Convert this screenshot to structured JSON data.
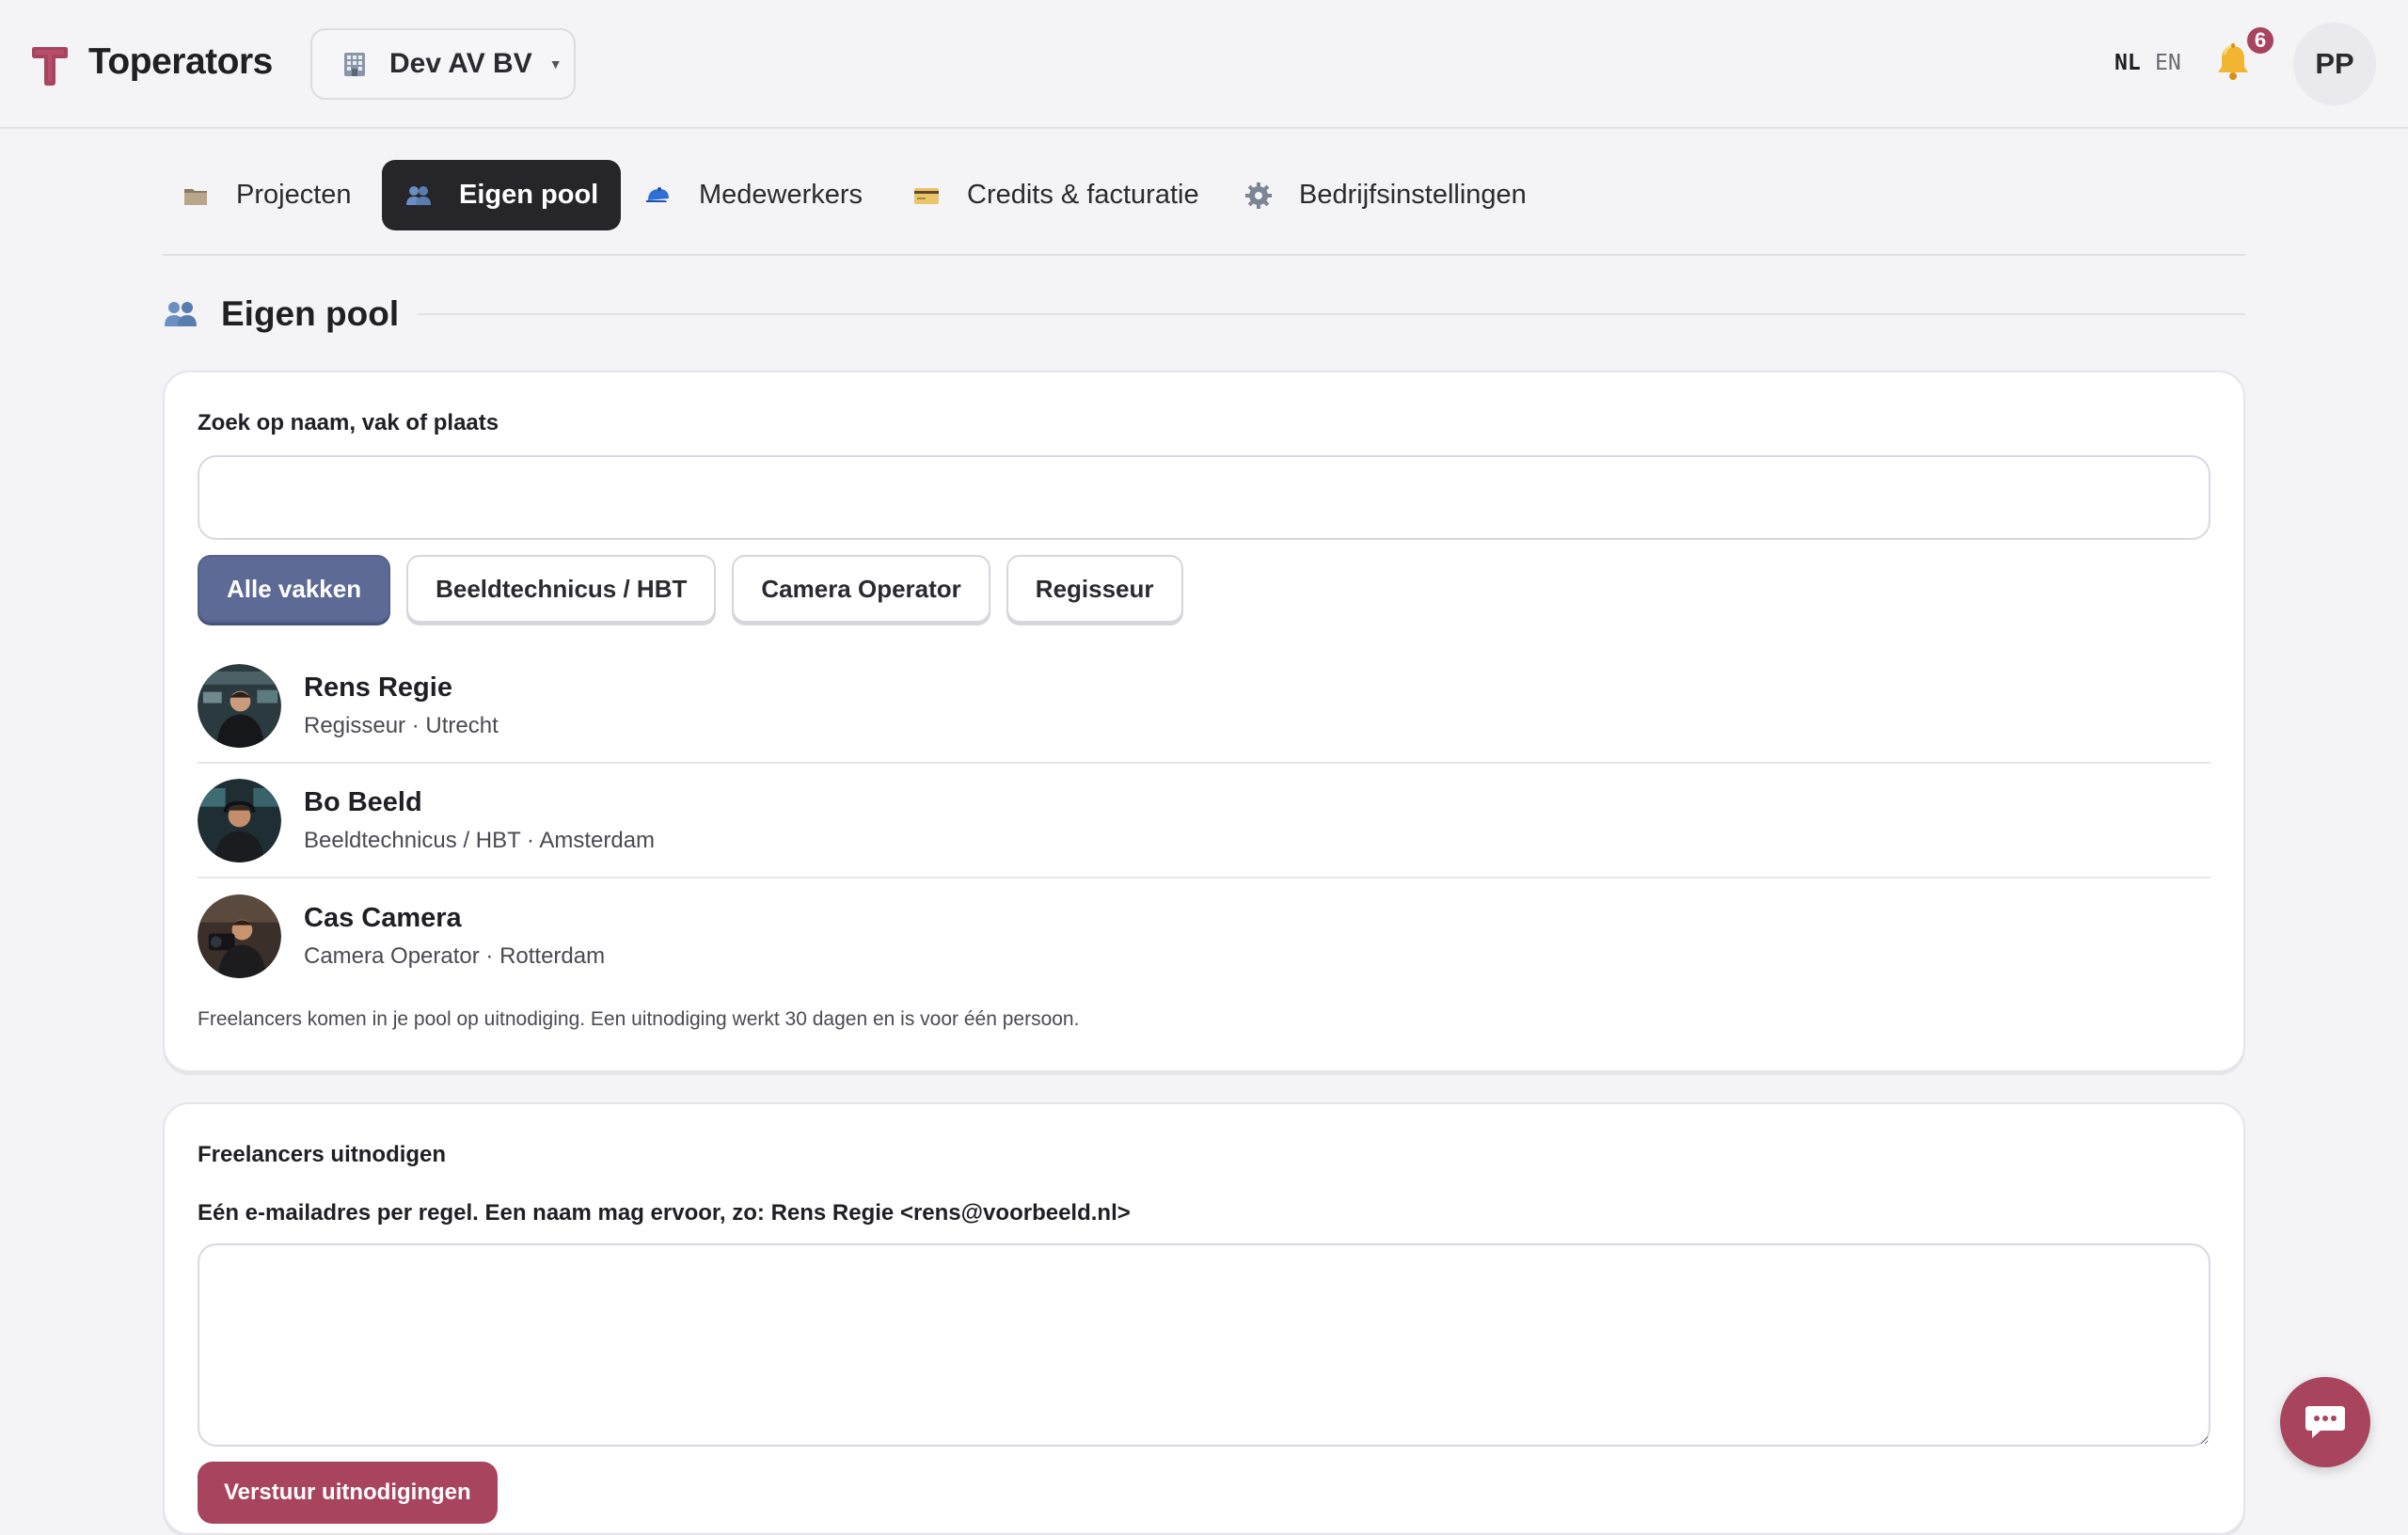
{
  "app": {
    "name": "Toperators",
    "company": "Dev AV BV",
    "languages": [
      {
        "code": "NL",
        "active": true
      },
      {
        "code": "EN",
        "active": false
      }
    ],
    "notifications_count": "6",
    "user_initials": "PP",
    "brand_color": "#a9445f",
    "chip_active_color": "#5c6a95"
  },
  "nav": {
    "tabs": [
      {
        "label": "Projecten",
        "icon": "folder-icon",
        "active": false
      },
      {
        "label": "Eigen pool",
        "icon": "people-icon",
        "active": true
      },
      {
        "label": "Medewerkers",
        "icon": "cap-icon",
        "active": false
      },
      {
        "label": "Credits & facturatie",
        "icon": "credit-card-icon",
        "active": false
      },
      {
        "label": "Bedrijfsinstellingen",
        "icon": "gear-icon",
        "active": false
      }
    ]
  },
  "section": {
    "title": "Eigen pool",
    "icon": "people-icon"
  },
  "pool": {
    "search_label": "Zoek op naam, vak of plaats",
    "search_value": "",
    "filters": [
      {
        "label": "Alle vakken",
        "active": true
      },
      {
        "label": "Beeldtechnicus / HBT",
        "active": false
      },
      {
        "label": "Camera Operator",
        "active": false
      },
      {
        "label": "Regisseur",
        "active": false
      }
    ],
    "people": [
      {
        "name": "Rens Regie",
        "meta": "Regisseur · Utrecht"
      },
      {
        "name": "Bo Beeld",
        "meta": "Beeldtechnicus / HBT · Amsterdam"
      },
      {
        "name": "Cas Camera",
        "meta": "Camera Operator · Rotterdam"
      }
    ],
    "note": "Freelancers komen in je pool op uitnodiging. Een uitnodiging werkt 30 dagen en is voor één persoon."
  },
  "invite": {
    "title": "Freelancers uitnodigen",
    "instructions": "Eén e-mailadres per regel. Een naam mag ervoor, zo: Rens Regie <rens@voorbeeld.nl>",
    "textarea_value": "",
    "submit_label": "Verstuur uitnodigingen"
  }
}
